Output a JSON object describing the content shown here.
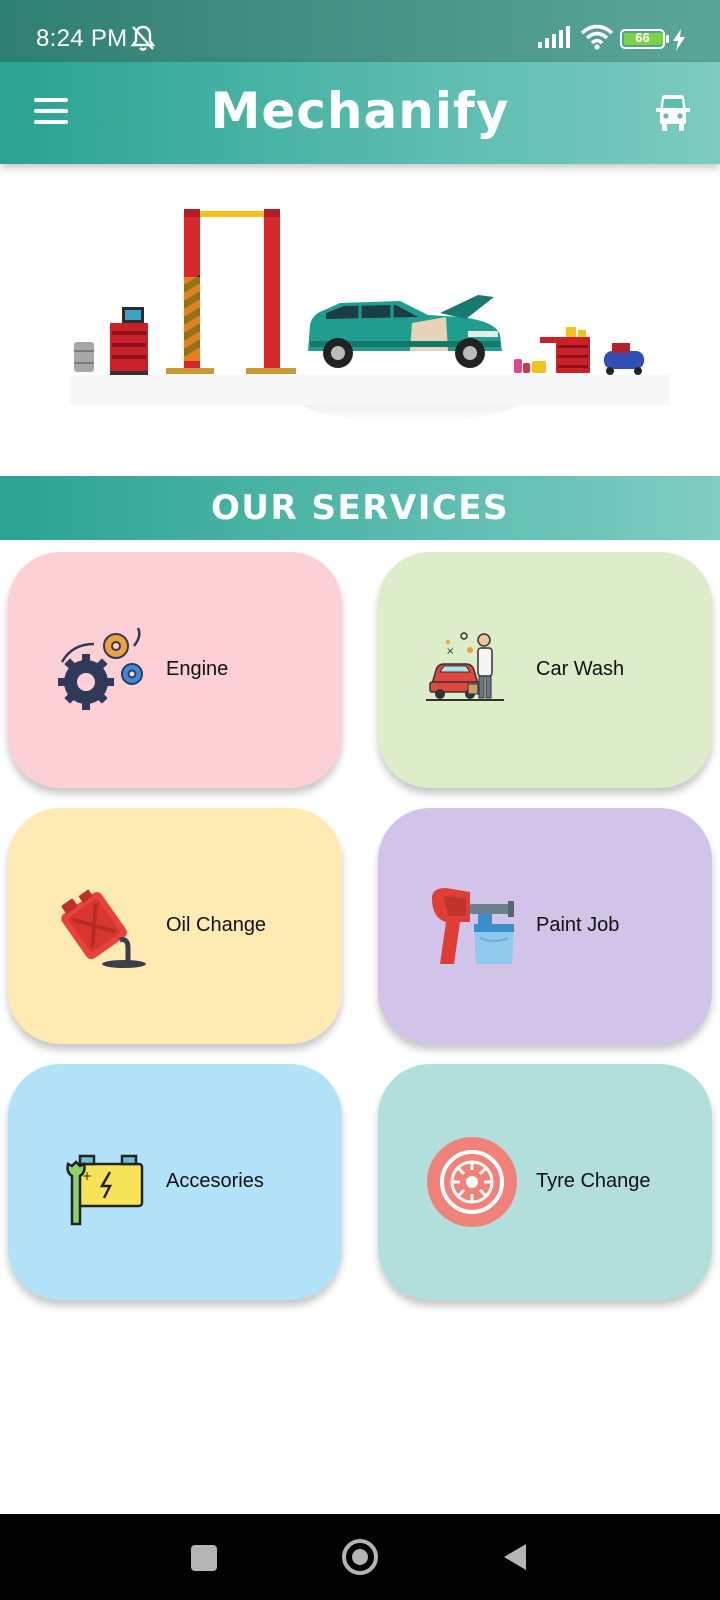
{
  "status_bar": {
    "time": "8:24 PM",
    "battery_level": "66",
    "icons": [
      "bell-off-icon",
      "signal-icon",
      "wifi-icon",
      "battery-icon",
      "charging-icon"
    ]
  },
  "app_bar": {
    "title": "Mechanify",
    "menu_icon": "hamburger-menu-icon",
    "action_icon": "car-front-icon"
  },
  "hero": {
    "illustration": "garage-illustration"
  },
  "services": {
    "title": "OUR SERVICES",
    "items": [
      {
        "label": "Engine",
        "icon": "engine-gears-icon",
        "color": "#fdd0d6"
      },
      {
        "label": "Car Wash",
        "icon": "car-wash-icon",
        "color": "#ddecc9"
      },
      {
        "label": "Oil Change",
        "icon": "oil-can-icon",
        "color": "#feeab3"
      },
      {
        "label": "Paint Job",
        "icon": "spray-gun-icon",
        "color": "#d2c4e8"
      },
      {
        "label": "Accesories",
        "icon": "battery-wrench-icon",
        "color": "#b3e3f9"
      },
      {
        "label": "Tyre Change",
        "icon": "tyre-icon",
        "color": "#b2dfdb"
      }
    ]
  },
  "nav_bar": {
    "icons": [
      "recent-apps-icon",
      "home-icon",
      "back-icon"
    ]
  }
}
